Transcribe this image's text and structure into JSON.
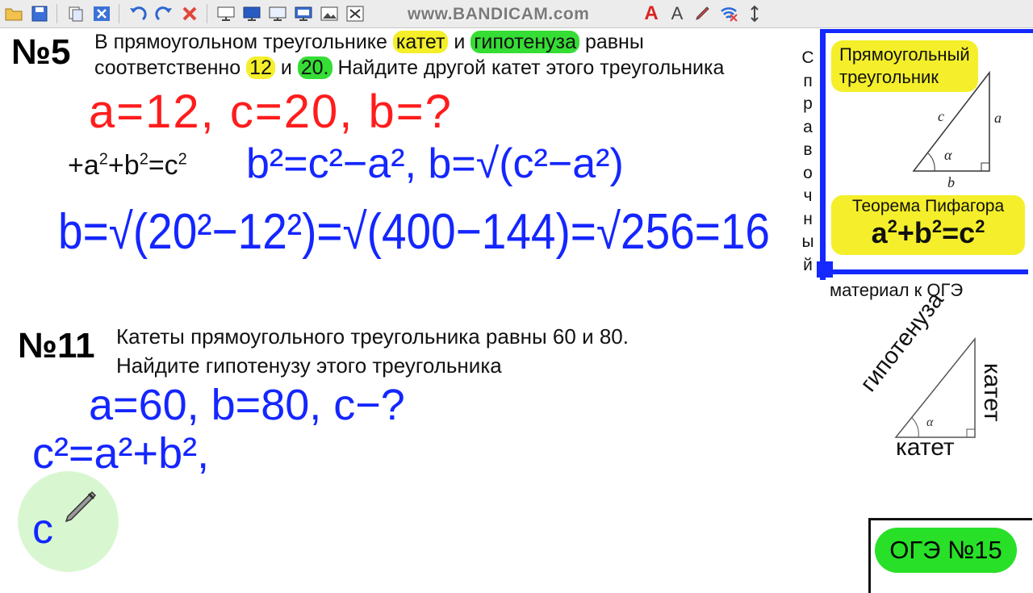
{
  "watermark": "www.BANDICAM.com",
  "toolbar": {
    "icons": [
      "folder-icon",
      "save-icon",
      "copy-icon",
      "close-window-icon",
      "undo-icon",
      "redo-icon",
      "delete-icon",
      "screen-icon",
      "monitor-icon",
      "monitor2-icon",
      "monitor3-icon",
      "picture-icon",
      "cut-icon",
      "font-color-icon",
      "font-size-icon",
      "pen-icon",
      "wifi-tool-icon",
      "resize-icon"
    ],
    "font_color_glyph": "A",
    "font_size_glyph": "A"
  },
  "problem5": {
    "number": "№5",
    "line1_pre": "В прямоугольном треугольнике ",
    "line1_hl1": "катет",
    "line1_mid": " и ",
    "line1_hl2": "гипотенуза",
    "line1_post": " равны",
    "line2_pre": "соответственно ",
    "line2_hl1": "12",
    "line2_mid": " и ",
    "line2_hl2": "20.",
    "line2_post": " Найдите другой катет этого треугольника",
    "printed_formula": {
      "a": "a",
      "b": "b",
      "c": "c",
      "exp": "2",
      "prefix": "+"
    }
  },
  "problem5_ink": {
    "line1": "a=12, c=20, b=?",
    "line2": "b²=c²−a², b=√(c²−a²)",
    "line3": "b=√(20²−12²)=√(400−144)=√256=16"
  },
  "problem11": {
    "number": "№11",
    "line1": "Катеты прямоугольного треугольника равны 60 и 80.",
    "line2": "Найдите гипотенузу этого треугольника"
  },
  "problem11_ink": {
    "line1": "a=60, b=80, c−?",
    "line2": "c²=a²+b²,",
    "line3": "c"
  },
  "reference": {
    "vertical_letters": [
      "С",
      "п",
      "р",
      "а",
      "в",
      "о",
      "ч",
      "н",
      "ы",
      "й"
    ],
    "title_line1": "Прямоугольный",
    "title_line2": "треугольник",
    "side_c": "c",
    "side_a": "a",
    "side_b": "b",
    "angle": "α",
    "theorem_label": "Теорема Пифагора",
    "theorem_formula": {
      "a": "a",
      "b": "b",
      "c": "c",
      "exp": "2"
    },
    "caption": "материал к ОГЭ"
  },
  "triangle2": {
    "hypotenuse": "гипотенуза",
    "leg_vertical": "катет",
    "leg_bottom": "катет",
    "angle": "α"
  },
  "badge": "ОГЭ №15",
  "colors": {
    "ink_red": "#ff1c1c",
    "ink_blue": "#1426ff",
    "highlight_yellow": "#f4ef2a",
    "highlight_green": "#35dd35",
    "frame_blue": "#1428ff",
    "badge_green": "#28e028"
  }
}
